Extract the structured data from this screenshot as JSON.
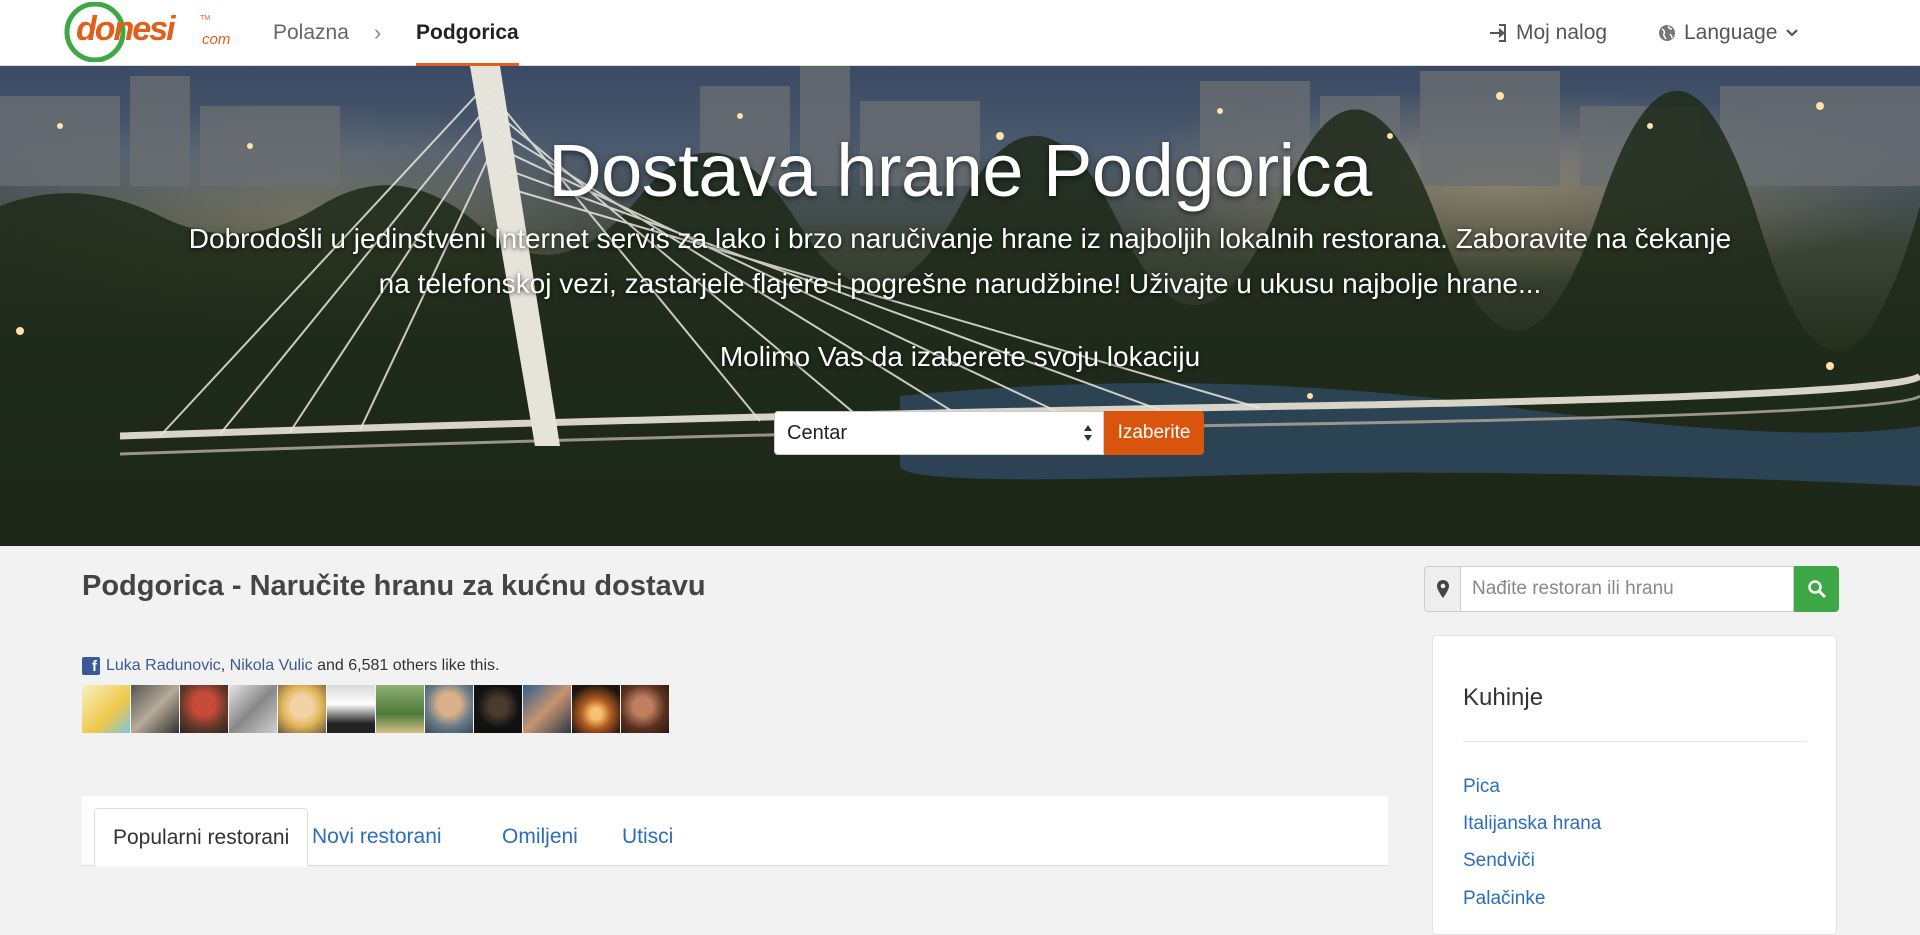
{
  "header": {
    "logo_text": "donesi.com",
    "breadcrumb": {
      "home": "Polazna",
      "separator": "›",
      "current": "Podgorica"
    },
    "account_label": "Moj nalog",
    "language_label": "Language",
    "accent_color": "#e0601b"
  },
  "hero": {
    "title": "Dostava hrane Podgorica",
    "subtitle_line1": "Dobrodošli u jedinstveni Internet servis za lako i brzo naručivanje hrane iz najboljih lokalnih restorana. Zaboravite na čekanje",
    "subtitle_line2": "na telefonskoj vezi, zastarjele flajere i pogrešne narudžbine! Uživajte u ukusu najbolje hrane...",
    "location_prompt": "Molimo Vas da izaberete svoju lokaciju",
    "location_selected": "Centar",
    "location_button": "Izaberite",
    "button_color": "#d9550e"
  },
  "main": {
    "heading": "Podgorica - Naručite hranu za kućnu dostavu",
    "facebook": {
      "friend1": "Luka Radunovic",
      "comma": ",",
      "friend2": "Nikola Vulic",
      "rest": "and 6,581 others like this."
    },
    "tabs": [
      {
        "label": "Popularni restorani",
        "active": true
      },
      {
        "label": "Novi restorani",
        "active": false
      },
      {
        "label": "Omiljeni",
        "active": false
      },
      {
        "label": "Utisci",
        "active": false
      }
    ]
  },
  "search": {
    "placeholder": "Nađite restoran ili hranu",
    "button_color": "#3ea846"
  },
  "sidebar": {
    "title": "Kuhinje",
    "items": [
      "Pica",
      "Italijanska hrana",
      "Sendviči",
      "Palačinke"
    ]
  }
}
